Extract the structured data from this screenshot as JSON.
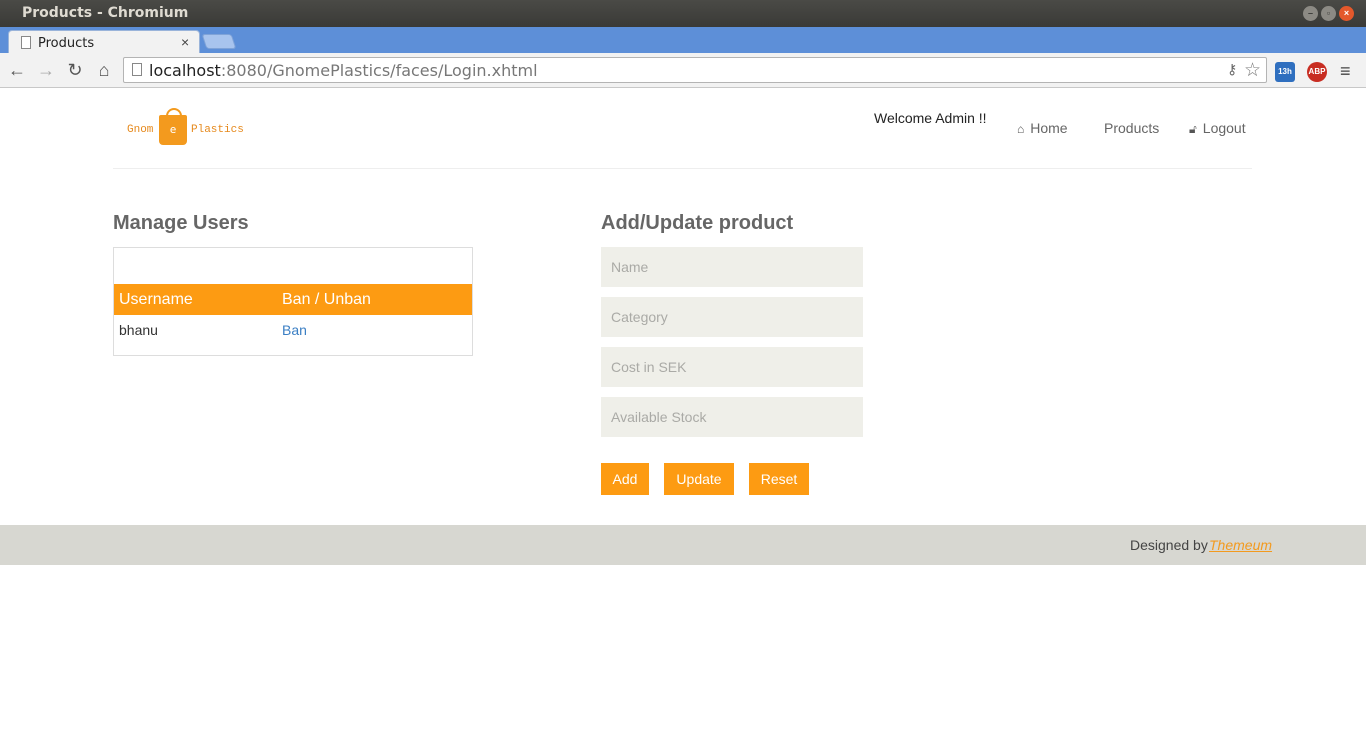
{
  "window": {
    "title": "Products - Chromium"
  },
  "tabs": [
    {
      "title": "Products",
      "close_glyph": "×"
    }
  ],
  "toolbar": {
    "url_host": "localhost",
    "url_rest": ":8080/GnomePlastics/faces/Login.xhtml",
    "calendar_badge": "13h",
    "abp_badge": "ABP"
  },
  "header": {
    "logo": {
      "word1": "Gnom",
      "bag_letter": "e",
      "word2": "Plastics"
    },
    "welcome": "Welcome Admin !!",
    "nav": {
      "home": "Home",
      "products": "Products",
      "logout": "Logout"
    }
  },
  "manage_users": {
    "title": "Manage Users",
    "columns": [
      "Username",
      "Ban / Unban"
    ],
    "rows": [
      {
        "username": "bhanu",
        "action": "Ban"
      }
    ]
  },
  "product_form": {
    "title": "Add/Update product",
    "fields": {
      "name": {
        "placeholder": "Name",
        "value": ""
      },
      "category": {
        "placeholder": "Category",
        "value": ""
      },
      "cost": {
        "placeholder": "Cost in SEK",
        "value": ""
      },
      "stock": {
        "placeholder": "Available Stock",
        "value": ""
      }
    },
    "buttons": {
      "add": "Add",
      "update": "Update",
      "reset": "Reset"
    }
  },
  "footer": {
    "designed_by": "Designed by",
    "link": "Themeum"
  },
  "colors": {
    "accent": "#fd9b12",
    "link": "#3b7fc4",
    "footer_bg": "#d7d7d1",
    "field_bg": "#efefe9"
  }
}
